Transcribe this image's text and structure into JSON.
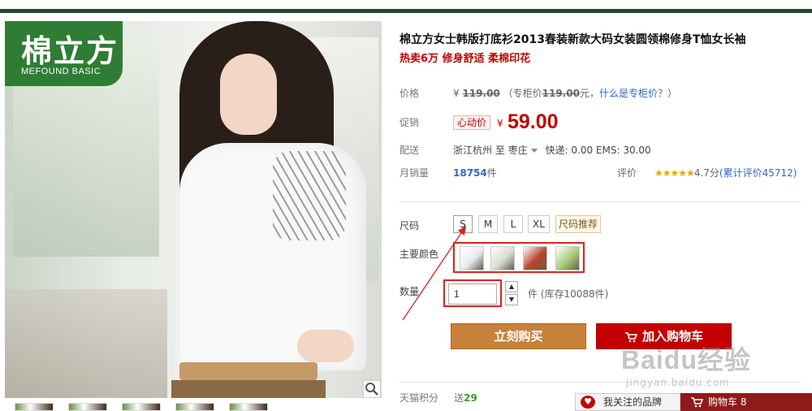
{
  "brand": {
    "name_cn": "棉立方",
    "name_en": "MEFOUND BASIC"
  },
  "product": {
    "title": "棉立方女士韩版打底衫2013春装新款大码女装圆领棉修身T恤女长袖",
    "subtitle": "热卖6万 修身舒适 柔棉印花"
  },
  "price": {
    "label": "价格",
    "currency": "¥",
    "original": "119.00",
    "counter_prefix": "（专柜价",
    "counter_value": "119.00",
    "counter_suffix": "元，",
    "counter_link": "什么是专柜价？",
    "close_paren": "）"
  },
  "promo": {
    "label": "促销",
    "tag": "心动价",
    "currency": "¥",
    "price": "59.00"
  },
  "shipping": {
    "label": "配送",
    "from": "浙江杭州",
    "to_word": "至",
    "dest": "枣庄",
    "fees": "快递: 0.00 EMS: 30.00"
  },
  "sales": {
    "label": "月销量",
    "count": "18754",
    "unit": "件",
    "rating_label": "评价",
    "stars": "★★★★★",
    "score": "4.7分",
    "reviews_link": "(累计评价45712)"
  },
  "size": {
    "label": "尺码",
    "options": [
      "S",
      "M",
      "L",
      "XL"
    ],
    "selected": "S",
    "recommend": "尺码推荐"
  },
  "color": {
    "label": "主要颜色",
    "swatch_colors": [
      "#e9ecef",
      "#d8dcd3",
      "#b8432d",
      "#a9c97a"
    ]
  },
  "quantity": {
    "label": "数量",
    "value": "1",
    "stock": "件 (库存10088件)",
    "up": "▲",
    "down": "▼"
  },
  "actions": {
    "buy": "立刻购买",
    "cart": "加入购物车"
  },
  "points": {
    "label": "天猫积分",
    "prefix": "送",
    "value": "29"
  },
  "bottom_bar": {
    "follow": "我关注的品牌",
    "cart": "购物车 8"
  },
  "watermark": {
    "main": "Baidu经验",
    "url": "jingyan.baidu.com"
  }
}
